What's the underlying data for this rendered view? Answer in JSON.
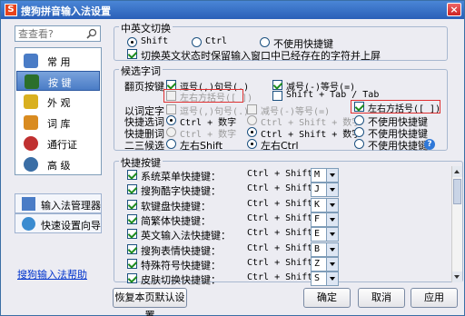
{
  "window": {
    "title": "搜狗拼音输入法设置",
    "logo_text": "S",
    "close_glyph": "×"
  },
  "search": {
    "placeholder": "查查看?"
  },
  "nav": {
    "items": [
      {
        "label": "常  用",
        "icon": "common-settings-icon",
        "color": "#4a7cc6"
      },
      {
        "label": "按  键",
        "icon": "keys-icon",
        "color": "#2b6f2b",
        "selected": true
      },
      {
        "label": "外  观",
        "icon": "appearance-icon",
        "color": "#d9b020"
      },
      {
        "label": "词  库",
        "icon": "dictionary-icon",
        "color": "#d98b20"
      },
      {
        "label": "通行证",
        "icon": "passport-icon",
        "color": "#c03030"
      },
      {
        "label": "高  级",
        "icon": "advanced-icon",
        "color": "#3a6ea5"
      }
    ]
  },
  "side_buttons": {
    "manager": "输入法管理器",
    "wizard": "快速设置向导"
  },
  "help_link": "搜狗输入法帮助",
  "cn_en": {
    "title": "中英文切换",
    "options": [
      "Shift",
      "Ctrl",
      "不使用快捷键"
    ],
    "selected": "Shift",
    "keep_input_label": "切换英文状态时保留输入窗口中已经存在的字符并上屏",
    "keep_input_checked": true
  },
  "candidates": {
    "title": "候选字词",
    "paging_label": "翻页按键",
    "paging_opts": [
      "逗号(,)句号(.)",
      "减号(-)等号(=)",
      "左右方括号([ ])",
      "Shift + Tab / Tab"
    ],
    "paging_checked": [
      true,
      true,
      false,
      false
    ],
    "word_select_label": "以词定字",
    "word_select_opts": [
      "逗号(,)句号(.)",
      "减号(-)等号(=)",
      "左右方括号([ ])"
    ],
    "word_select_checked": [
      false,
      false,
      true
    ],
    "quick_select_label": "快捷选词",
    "quick_select_opts": [
      "Ctrl + 数字",
      "Ctrl + Shift + 数字",
      "不使用快捷键"
    ],
    "quick_select_selected": "Ctrl + 数字",
    "quick_delete_label": "快捷删词",
    "quick_delete_opts": [
      "Ctrl + 数字",
      "Ctrl + Shift + 数字",
      "不使用快捷键"
    ],
    "quick_delete_selected": "Ctrl + Shift + 数字",
    "two_three_label": "二三候选",
    "two_three_opts": [
      "左右Shift",
      "左右Ctrl",
      "不使用快捷键"
    ],
    "two_three_selected": "左右Ctrl"
  },
  "hotkeys": {
    "title": "快捷按键",
    "prefix": "Ctrl + Shift +",
    "rows": [
      {
        "label": "系统菜单快捷键：",
        "key": "M",
        "checked": true
      },
      {
        "label": "搜狗酷字快捷键：",
        "key": "J",
        "checked": true
      },
      {
        "label": "软键盘快捷键：",
        "key": "K",
        "checked": true
      },
      {
        "label": "简繁体快捷键：",
        "key": "F",
        "checked": true
      },
      {
        "label": "英文输入法快捷键：",
        "key": "E",
        "checked": true
      },
      {
        "label": "搜狗表情快捷键：",
        "key": "B",
        "checked": true
      },
      {
        "label": "特殊符号快捷键：",
        "key": "Z",
        "checked": true
      },
      {
        "label": "皮肤切换快捷键：",
        "key": "S",
        "checked": true
      }
    ]
  },
  "footer": {
    "reset": "恢复本页默认设置",
    "ok": "确定",
    "cancel": "取消",
    "apply": "应用"
  },
  "help_icon_glyph": "?"
}
